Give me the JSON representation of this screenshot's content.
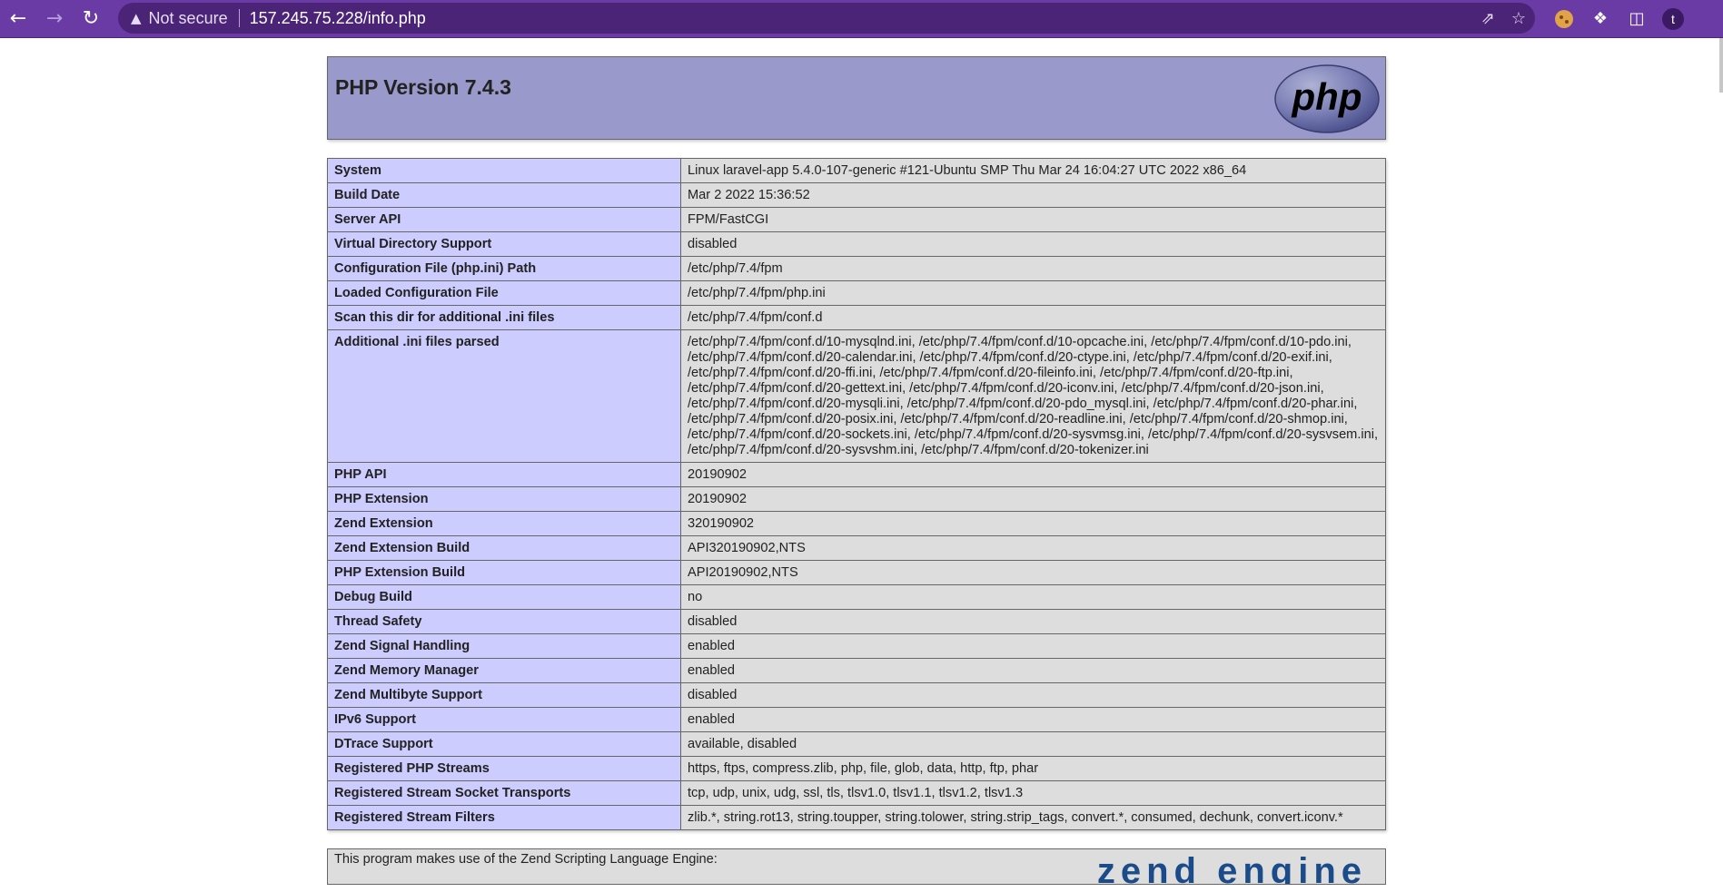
{
  "browser": {
    "security_label": "Not secure",
    "url": "157.245.75.228/info.php",
    "profile_initial": "t",
    "colors": {
      "toolbar": "#6a3aa5",
      "omnibox": "#4b2478"
    }
  },
  "icons": {
    "back": "arrow-left-icon",
    "forward": "arrow-right-icon",
    "reload": "reload-icon",
    "warning": "warning-triangle-icon",
    "share": "share-icon",
    "bookmark": "star-icon",
    "cookie_ext": "cookie-icon",
    "extensions": "puzzle-icon",
    "side_panel": "side-panel-icon"
  },
  "header": {
    "title": "PHP Version 7.4.3",
    "logo_text": "php",
    "colors": {
      "header_bg": "#9999cc",
      "key_bg": "#ccccff",
      "value_bg": "#dddddd"
    }
  },
  "rows": [
    {
      "key": "System",
      "value": "Linux laravel-app 5.4.0-107-generic #121-Ubuntu SMP Thu Mar 24 16:04:27 UTC 2022 x86_64"
    },
    {
      "key": "Build Date",
      "value": "Mar 2 2022 15:36:52"
    },
    {
      "key": "Server API",
      "value": "FPM/FastCGI"
    },
    {
      "key": "Virtual Directory Support",
      "value": "disabled"
    },
    {
      "key": "Configuration File (php.ini) Path",
      "value": "/etc/php/7.4/fpm"
    },
    {
      "key": "Loaded Configuration File",
      "value": "/etc/php/7.4/fpm/php.ini"
    },
    {
      "key": "Scan this dir for additional .ini files",
      "value": "/etc/php/7.4/fpm/conf.d"
    },
    {
      "key": "Additional .ini files parsed",
      "value": "/etc/php/7.4/fpm/conf.d/10-mysqlnd.ini, /etc/php/7.4/fpm/conf.d/10-opcache.ini, /etc/php/7.4/fpm/conf.d/10-pdo.ini, /etc/php/7.4/fpm/conf.d/20-calendar.ini, /etc/php/7.4/fpm/conf.d/20-ctype.ini, /etc/php/7.4/fpm/conf.d/20-exif.ini, /etc/php/7.4/fpm/conf.d/20-ffi.ini, /etc/php/7.4/fpm/conf.d/20-fileinfo.ini, /etc/php/7.4/fpm/conf.d/20-ftp.ini, /etc/php/7.4/fpm/conf.d/20-gettext.ini, /etc/php/7.4/fpm/conf.d/20-iconv.ini, /etc/php/7.4/fpm/conf.d/20-json.ini, /etc/php/7.4/fpm/conf.d/20-mysqli.ini, /etc/php/7.4/fpm/conf.d/20-pdo_mysql.ini, /etc/php/7.4/fpm/conf.d/20-phar.ini, /etc/php/7.4/fpm/conf.d/20-posix.ini, /etc/php/7.4/fpm/conf.d/20-readline.ini, /etc/php/7.4/fpm/conf.d/20-shmop.ini, /etc/php/7.4/fpm/conf.d/20-sockets.ini, /etc/php/7.4/fpm/conf.d/20-sysvmsg.ini, /etc/php/7.4/fpm/conf.d/20-sysvsem.ini, /etc/php/7.4/fpm/conf.d/20-sysvshm.ini, /etc/php/7.4/fpm/conf.d/20-tokenizer.ini"
    },
    {
      "key": "PHP API",
      "value": "20190902"
    },
    {
      "key": "PHP Extension",
      "value": "20190902"
    },
    {
      "key": "Zend Extension",
      "value": "320190902"
    },
    {
      "key": "Zend Extension Build",
      "value": "API320190902,NTS"
    },
    {
      "key": "PHP Extension Build",
      "value": "API20190902,NTS"
    },
    {
      "key": "Debug Build",
      "value": "no"
    },
    {
      "key": "Thread Safety",
      "value": "disabled"
    },
    {
      "key": "Zend Signal Handling",
      "value": "enabled"
    },
    {
      "key": "Zend Memory Manager",
      "value": "enabled"
    },
    {
      "key": "Zend Multibyte Support",
      "value": "disabled"
    },
    {
      "key": "IPv6 Support",
      "value": "enabled"
    },
    {
      "key": "DTrace Support",
      "value": "available, disabled"
    },
    {
      "key": "Registered PHP Streams",
      "value": "https, ftps, compress.zlib, php, file, glob, data, http, ftp, phar"
    },
    {
      "key": "Registered Stream Socket Transports",
      "value": "tcp, udp, unix, udg, ssl, tls, tlsv1.0, tlsv1.1, tlsv1.2, tlsv1.3"
    },
    {
      "key": "Registered Stream Filters",
      "value": "zlib.*, string.rot13, string.toupper, string.tolower, string.strip_tags, convert.*, consumed, dechunk, convert.iconv.*"
    }
  ],
  "footer": {
    "text": "This program makes use of the Zend Scripting Language Engine:",
    "logo_text": "zend engine"
  }
}
